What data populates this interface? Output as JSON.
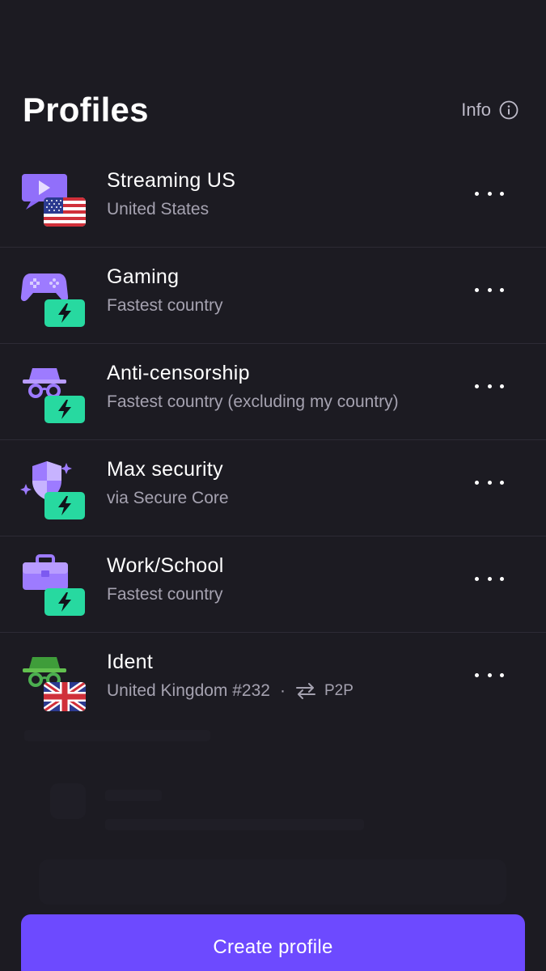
{
  "header": {
    "title": "Profiles",
    "info_label": "Info"
  },
  "profiles": [
    {
      "name": "Streaming US",
      "subtitle": "United States",
      "icon": "streaming-icon",
      "badge": "us-flag-icon"
    },
    {
      "name": "Gaming",
      "subtitle": "Fastest country",
      "icon": "gamepad-icon",
      "badge": "lightning-icon"
    },
    {
      "name": "Anti-censorship",
      "subtitle": "Fastest country (excluding my country)",
      "icon": "incognito-icon",
      "badge": "lightning-icon"
    },
    {
      "name": "Max security",
      "subtitle": "via Secure Core",
      "icon": "shield-icon",
      "badge": "lightning-icon"
    },
    {
      "name": "Work/School",
      "subtitle": "Fastest country",
      "icon": "briefcase-icon",
      "badge": "lightning-icon"
    },
    {
      "name": "Ident",
      "subtitle": "United Kingdom #232",
      "feature": "P2P",
      "icon": "incognito-icon",
      "badge": "uk-flag-icon"
    }
  ],
  "create_button_label": "Create profile",
  "colors": {
    "background": "#1c1b22",
    "accent": "#6d4aff",
    "badge_green": "#27d9a0",
    "icon_purple": "#9d7bff",
    "icon_green": "#4caf50"
  }
}
